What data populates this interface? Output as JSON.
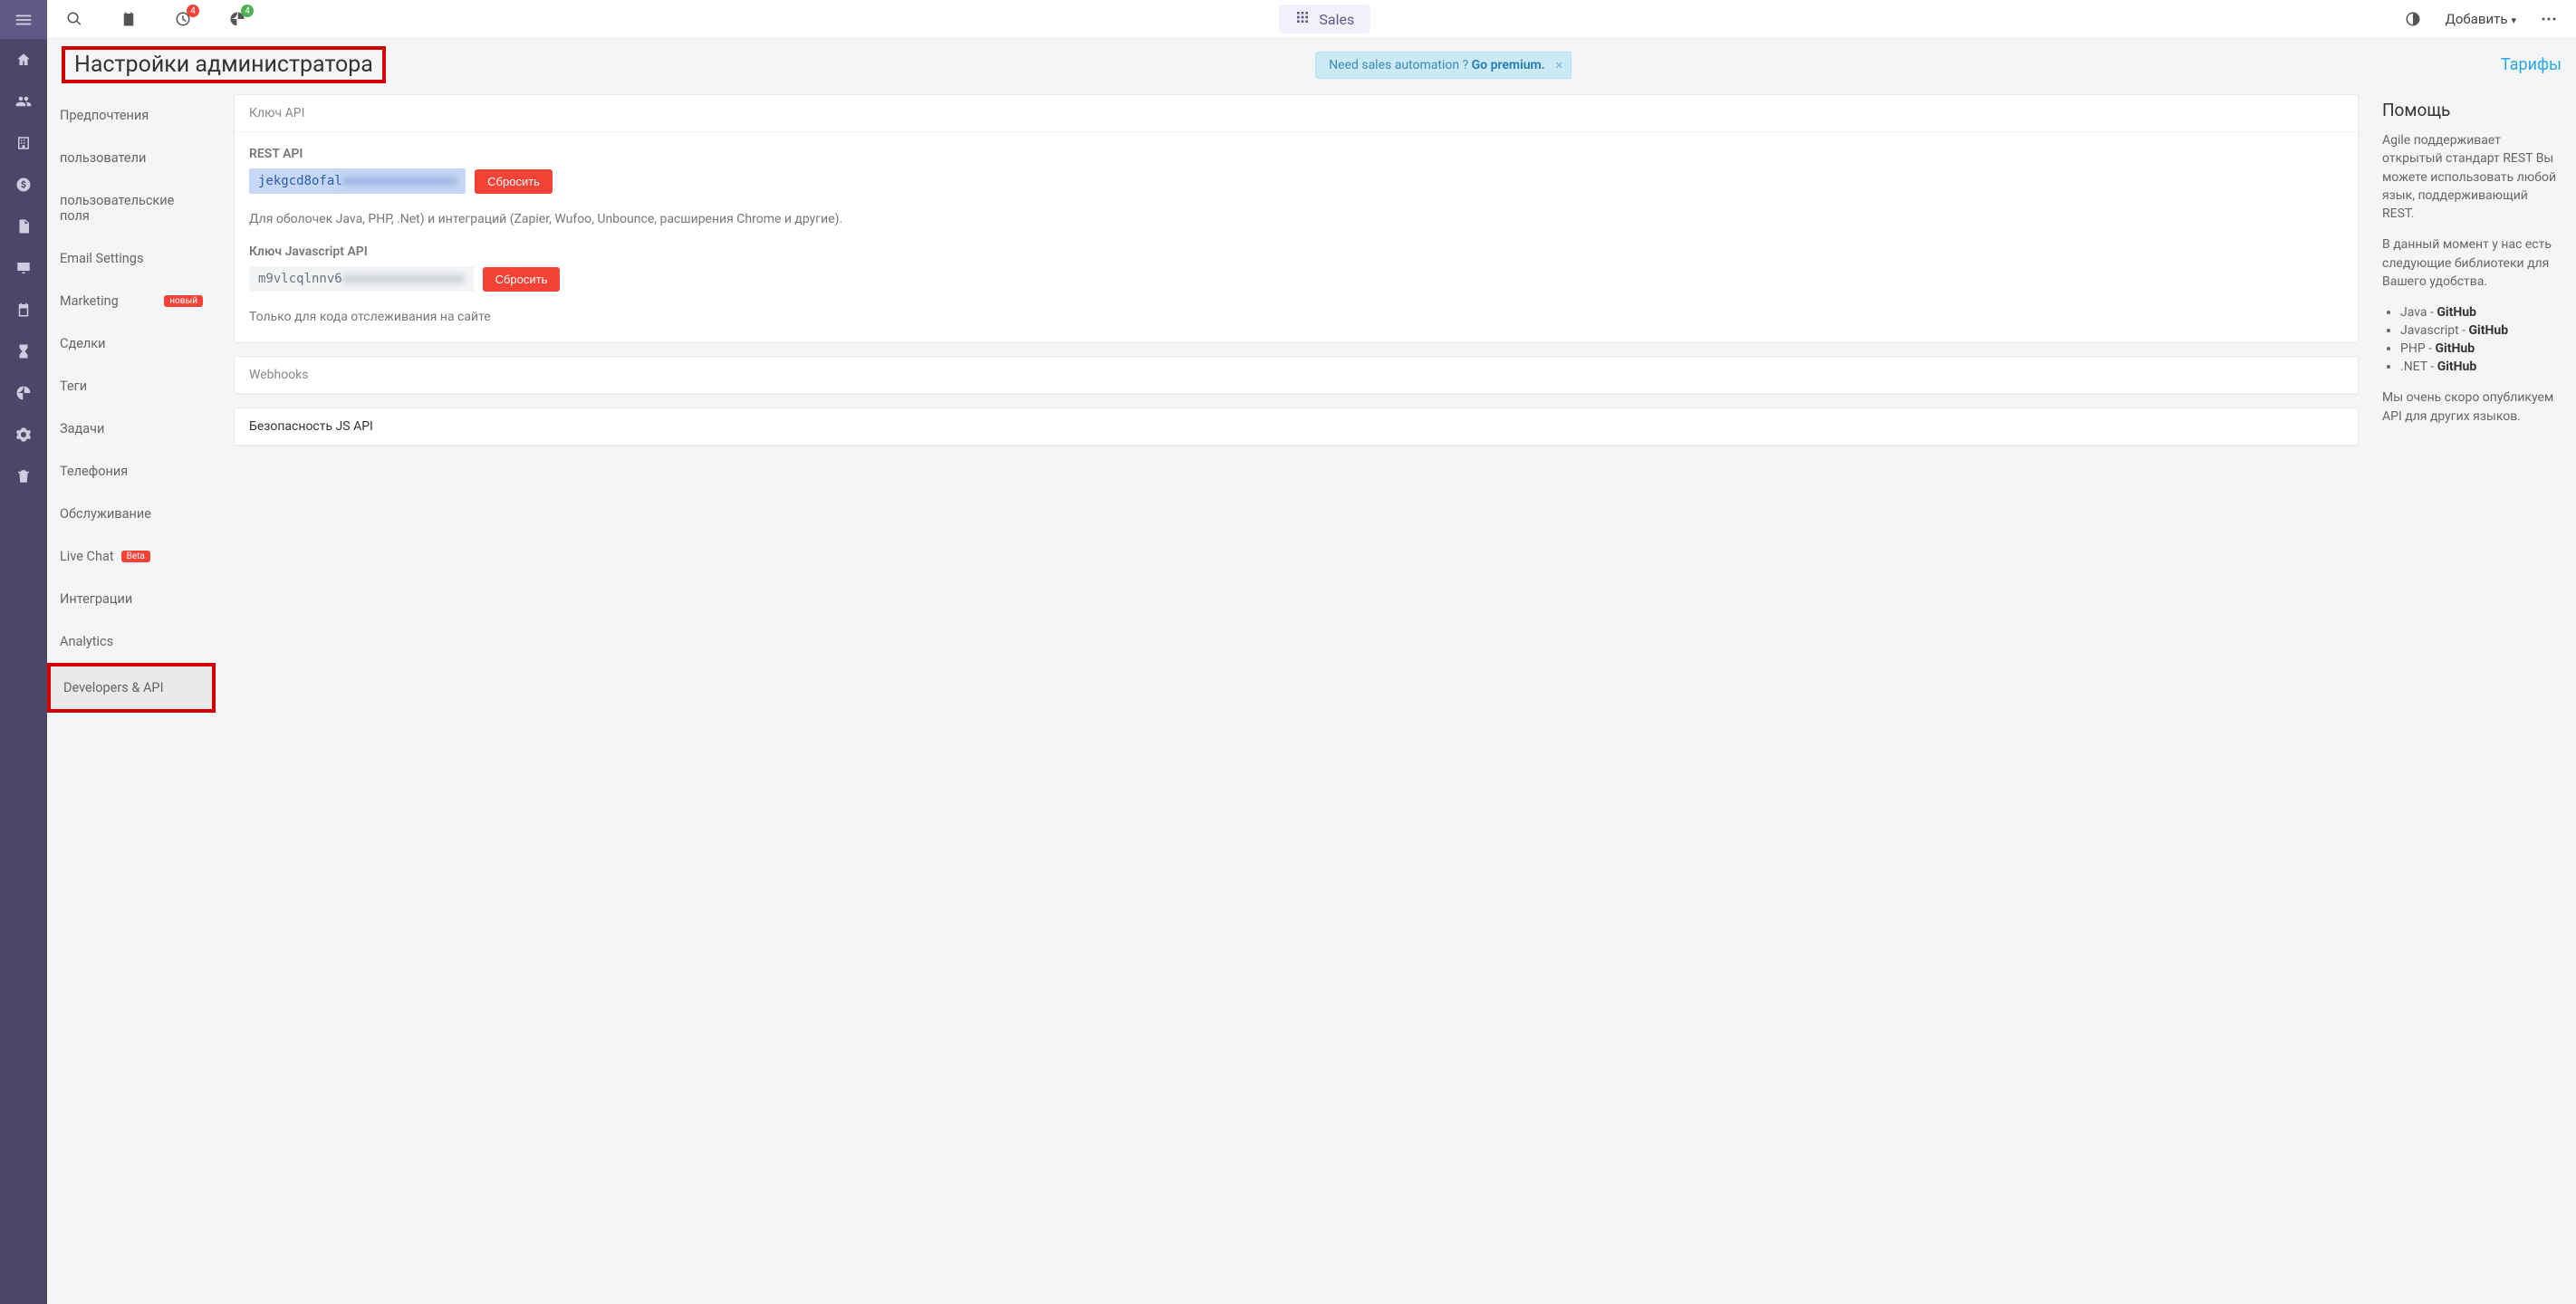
{
  "topbar": {
    "timer_badge": "4",
    "pie_badge": "4",
    "center_label": "Sales",
    "add_label": "Добавить"
  },
  "page": {
    "title": "Настройки администратора",
    "alert_text": "Need sales automation ? ",
    "alert_link": "Go premium.",
    "tariff_link": "Тарифы"
  },
  "settings_nav": {
    "items": [
      {
        "label": "Предпочтения"
      },
      {
        "label": "пользователи"
      },
      {
        "label": "пользовательские поля"
      },
      {
        "label": "Email Settings"
      },
      {
        "label": "Marketing",
        "badge": "новый"
      },
      {
        "label": "Сделки"
      },
      {
        "label": "Теги"
      },
      {
        "label": "Задачи"
      },
      {
        "label": "Телефония"
      },
      {
        "label": "Обслуживание"
      },
      {
        "label": "Live Chat",
        "badge": "Beta"
      },
      {
        "label": "Интеграции"
      },
      {
        "label": "Analytics"
      },
      {
        "label": "Developers & API"
      }
    ]
  },
  "api_card": {
    "header": "Ключ API",
    "rest_label": "REST API",
    "rest_value_visible": "jekgcd8ofal",
    "rest_value_hidden": "xxxxxxxxxxxxxxx",
    "reset_label": "Сбросить",
    "rest_desc": "Для оболочек Java, PHP, .Net) и интеграций (Zapier, Wufoo, Unbounce, расширения Chrome и другие).",
    "js_label": "Ключ Javascript API",
    "js_value_visible": "m9vlcqlnnv6",
    "js_value_hidden": "xxxxxxxxxxxxxxxx",
    "js_desc": "Только для кода отслеживания на сайте"
  },
  "webhooks_card": {
    "header": "Webhooks"
  },
  "jssec_card": {
    "header": "Безопасность JS API"
  },
  "help": {
    "title": "Помощь",
    "p1": "Agile поддерживает открытый стандарт REST Вы можете использовать любой язык, поддерживающий REST.",
    "p2": "В данный момент у нас есть следующие библиотеки для Вашего удобства.",
    "libs": [
      {
        "lang": "Java",
        "link": "GitHub"
      },
      {
        "lang": "Javascript",
        "link": "GitHub"
      },
      {
        "lang": "PHP",
        "link": "GitHub"
      },
      {
        "lang": ".NET",
        "link": "GitHub"
      }
    ],
    "p3": "Мы очень скоро опубликуем API для других языков."
  }
}
